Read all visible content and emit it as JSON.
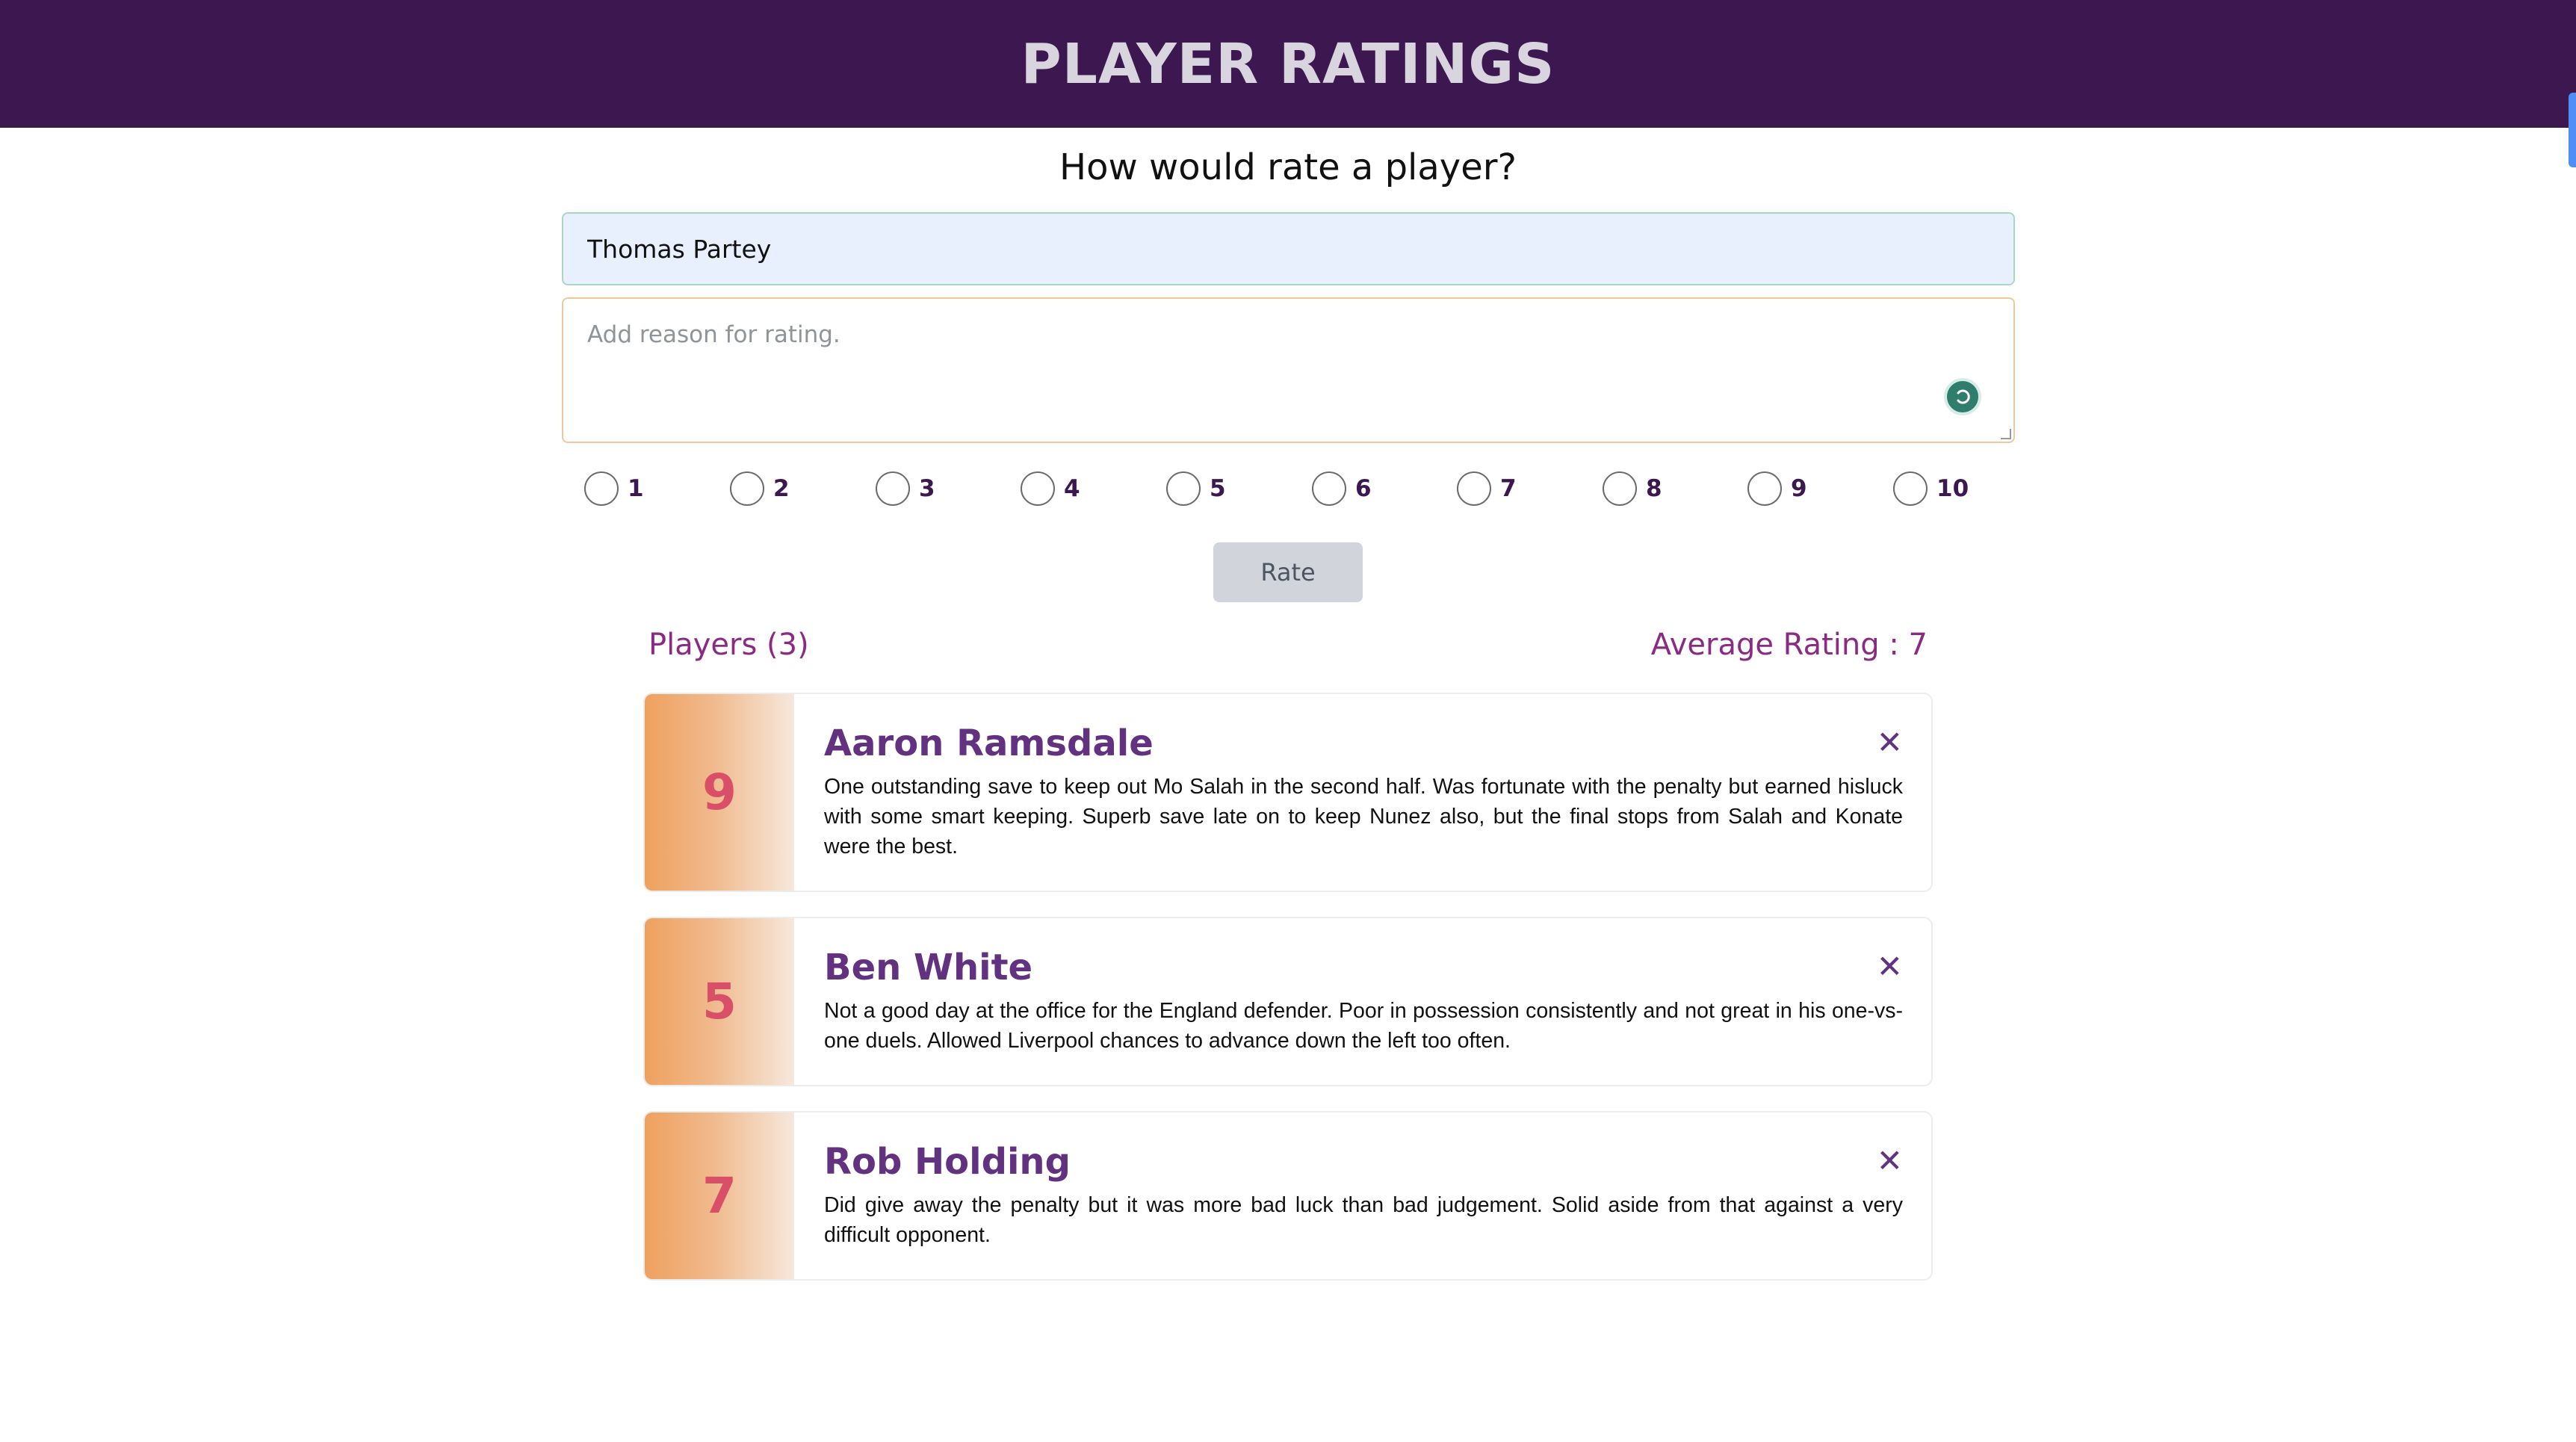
{
  "header": {
    "title": "PLAYER RATINGS"
  },
  "form": {
    "question": "How would rate a player?",
    "player_name_value": "Thomas Partey",
    "reason_placeholder": "Add reason for rating.",
    "rating_options": [
      "1",
      "2",
      "3",
      "4",
      "5",
      "6",
      "7",
      "8",
      "9",
      "10"
    ],
    "rate_button_label": "Rate"
  },
  "summary": {
    "players_label": "Players (3)",
    "average_label": "Average Rating : 7"
  },
  "players": [
    {
      "rating": "9",
      "name": "Aaron Ramsdale",
      "reason": "One outstanding save to keep out Mo Salah in the second half. Was fortunate with the penalty but earned hisluck with some smart keeping. Superb save late on to keep Nunez also, but the final stops from Salah and Konate were the best.",
      "close_label": "✕"
    },
    {
      "rating": "5",
      "name": "Ben White",
      "reason": "Not a good day at the office for the England defender. Poor in possession consistently and not great in his one-vs-one duels. Allowed Liverpool chances to advance down the left too often.",
      "close_label": "✕"
    },
    {
      "rating": "7",
      "name": "Rob Holding",
      "reason": "Did give away the penalty but it was more bad luck than bad judgement. Solid aside from that against a very difficult opponent.",
      "close_label": "✕"
    }
  ],
  "colors": {
    "header_bg": "#3c1750",
    "accent_purple": "#623280",
    "score_red": "#d94f68",
    "summary_text": "#8a2a82"
  }
}
